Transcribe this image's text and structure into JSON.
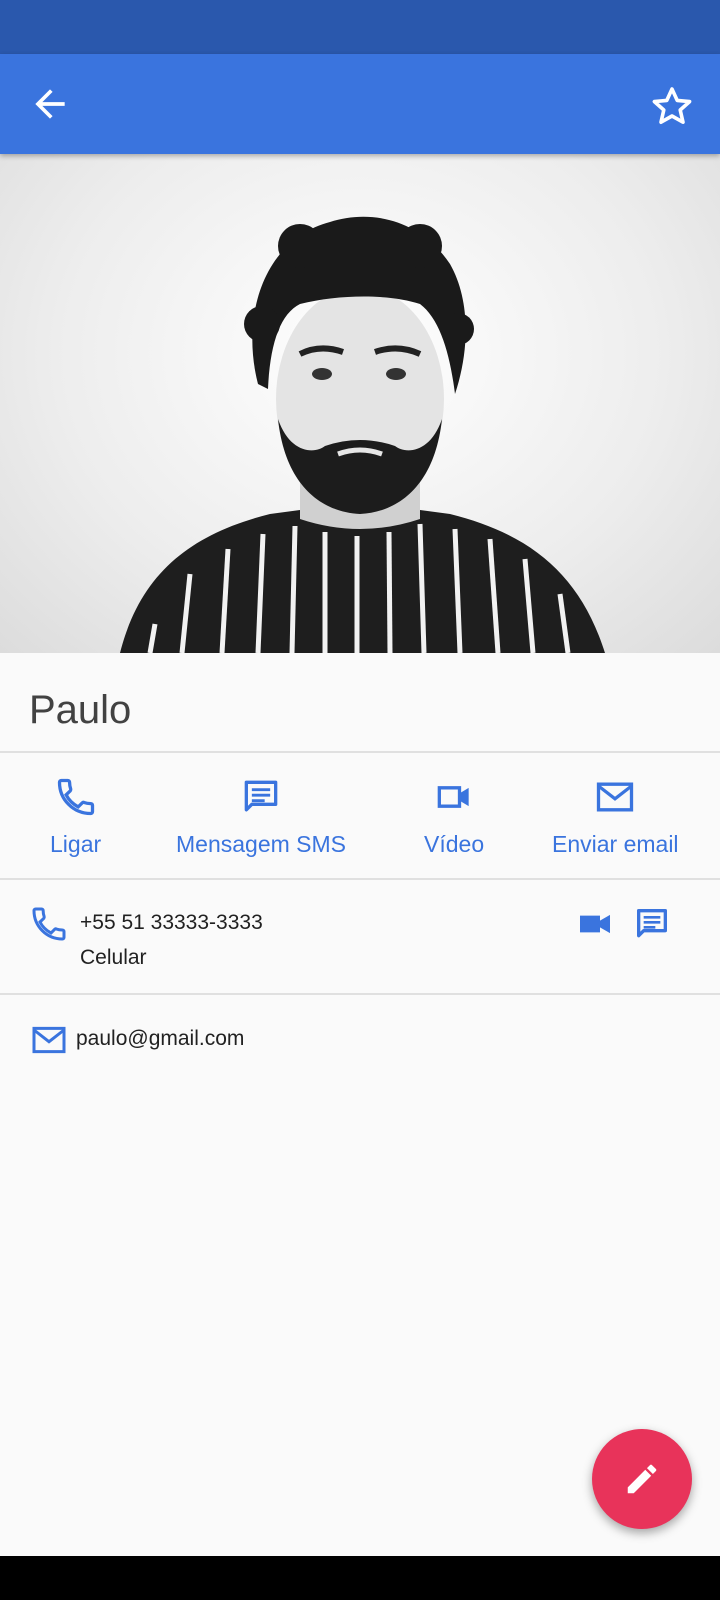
{
  "contact": {
    "name": "Paulo",
    "phone": {
      "number": "+55 51 33333-3333",
      "type": "Celular"
    },
    "email": "paulo@gmail.com"
  },
  "actions": [
    {
      "label": "Ligar",
      "icon": "phone-icon"
    },
    {
      "label": "Mensagem SMS",
      "icon": "message-icon"
    },
    {
      "label": "Vídeo",
      "icon": "video-icon"
    },
    {
      "label": "Enviar email",
      "icon": "email-icon"
    }
  ],
  "colors": {
    "status_bar": "#2a58ad",
    "app_bar": "#3a74de",
    "accent": "#3a74de",
    "fab": "#e8335a",
    "background": "#fafafa"
  },
  "icons": {
    "back": "arrow-back-icon",
    "favorite": "star-outline-icon",
    "edit": "pencil-icon"
  }
}
